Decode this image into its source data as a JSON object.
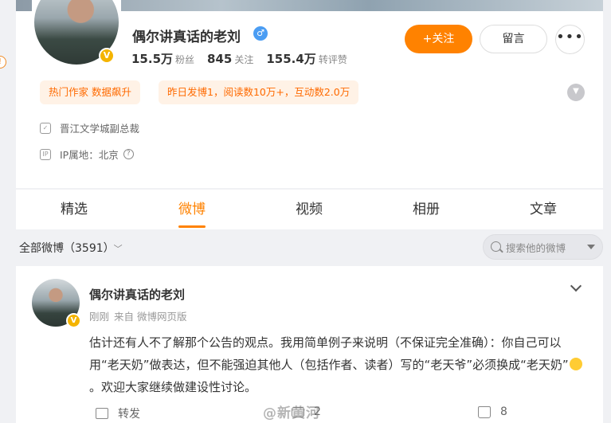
{
  "profile": {
    "name": "偶尔讲真话的老刘",
    "gender_icon": "male-icon",
    "verified_badge": "V",
    "stats": [
      {
        "value": "15.5万",
        "label": "粉丝"
      },
      {
        "value": "845",
        "label": "关注"
      },
      {
        "value": "155.4万",
        "label": "转评赞"
      }
    ],
    "follow_label": "+关注",
    "message_label": "留言",
    "more_label": "•••",
    "tags": [
      "热门作家 数据飙升",
      "昨日发博1，阅读数10万+，互动数2.0万"
    ],
    "company": "晋江文学城副总裁",
    "ip_location": "IP属地：北京",
    "ip_icon_text": "IP",
    "help_icon": "?"
  },
  "tabs": [
    "精选",
    "微博",
    "视频",
    "相册",
    "文章"
  ],
  "active_tab": "微博",
  "filter": {
    "label": "全部微博（3591）",
    "chevron": "﹀"
  },
  "search": {
    "placeholder": "搜索他的微博"
  },
  "post": {
    "author": "偶尔讲真话的老刘",
    "time": "刚刚",
    "source": "来自 微博网页版",
    "text_before_emoji": "估计还有人不了解那个公告的观点。我用简单例子来说明（不保证完全准确）：你自己可以用“老天奶”做表达，但不能强迫其他人（包括作者、读者）写的“老天爷”必须换成“老天奶”",
    "text_after_emoji": "。欢迎大家继续做建设性讨论。",
    "actions": {
      "repost_label": "转发",
      "comment_count": "2",
      "like_count": "8"
    }
  },
  "watermark": "@新黄河",
  "colors": {
    "accent": "#ff8200",
    "tag_bg": "#fff2e6",
    "tag_text": "#ff6a00",
    "verified": "#f4b400"
  }
}
